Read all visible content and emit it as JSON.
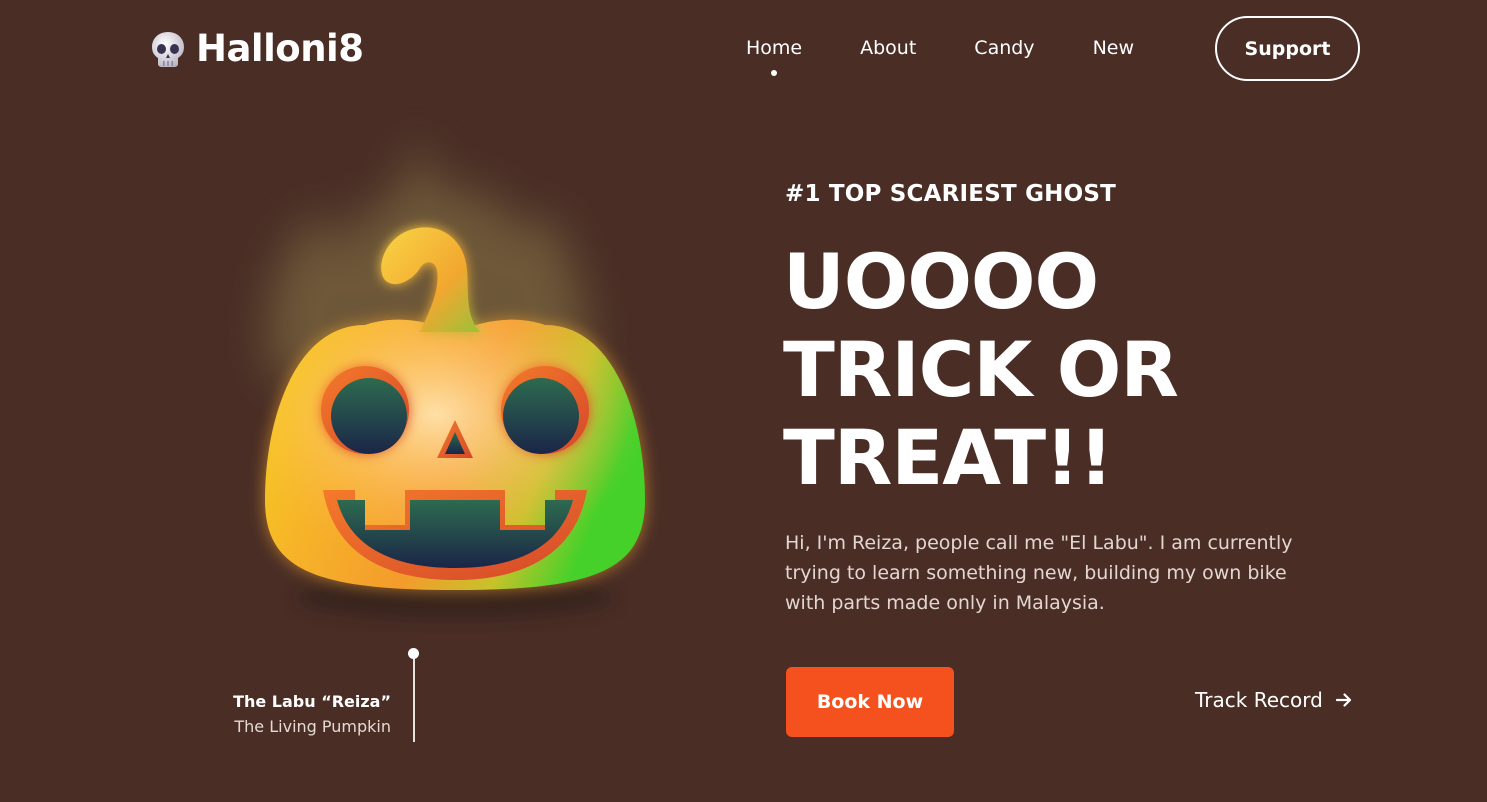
{
  "brand": {
    "name": "Halloni8",
    "icon": "skull-icon"
  },
  "nav": {
    "items": [
      {
        "label": "Home",
        "active": true
      },
      {
        "label": "About",
        "active": false
      },
      {
        "label": "Candy",
        "active": false
      },
      {
        "label": "New",
        "active": false
      }
    ],
    "support_label": "Support"
  },
  "hero": {
    "eyebrow": "#1 TOP SCARIEST GHOST",
    "headline": [
      "UOOOO",
      "TRICK OR",
      "TREAT!!"
    ],
    "description": "Hi, I'm Reiza, people call me \"El Labu\". I am currently trying to learn something new, building my own bike with parts made only in Malaysia.",
    "book_label": "Book Now",
    "track_label": "Track Record",
    "track_icon": "arrow-right-icon"
  },
  "character": {
    "name": "The Labu “Reiza”",
    "subtitle": "The Living Pumpkin",
    "image": "jack-o-lantern-pumpkin"
  },
  "colors": {
    "background": "#4a2e26",
    "accent": "#f4511e",
    "text": "#ffffff",
    "muted": "#e3d6d1"
  }
}
